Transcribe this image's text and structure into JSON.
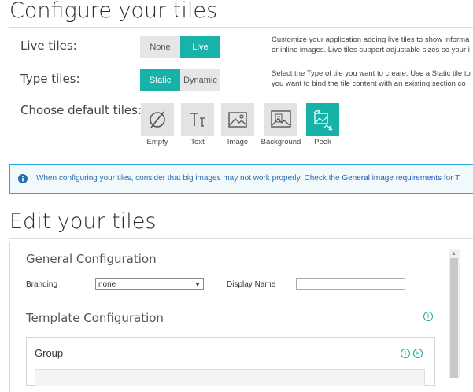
{
  "configure": {
    "title": "Configure your tiles",
    "live_tiles": {
      "label": "Live tiles:",
      "options": [
        "None",
        "Live"
      ],
      "selected": "Live",
      "description": [
        "Customize your application adding live tiles to show informa",
        "or inline images. Live tiles support adjustable sizes so your i"
      ]
    },
    "type_tiles": {
      "label": "Type tiles:",
      "options": [
        "Static",
        "Dynamic"
      ],
      "selected": "Static",
      "description": [
        "Select the Type of tile you want to create. Use a Static tile to",
        "you want to bind the tile content with an existing section co"
      ]
    },
    "default_tiles": {
      "label": "Choose default tiles:",
      "items": [
        {
          "label": "Empty",
          "icon": "empty-set-icon"
        },
        {
          "label": "Text",
          "icon": "text-icon"
        },
        {
          "label": "Image",
          "icon": "image-icon"
        },
        {
          "label": "Background",
          "icon": "background-icon"
        },
        {
          "label": "Peek",
          "icon": "peek-icon"
        }
      ],
      "selected": "Peek"
    }
  },
  "notice": {
    "text": "When configuring your tiles, consider that big images may not work properly. Check the ",
    "link": "General image requirements",
    "suffix": " for T"
  },
  "edit": {
    "title": "Edit your tiles",
    "general_title": "General Configuration",
    "branding_label": "Branding",
    "branding_value": "none",
    "display_name_label": "Display Name",
    "display_name_value": "",
    "template_title": "Template Configuration",
    "group_title": "Group"
  },
  "colors": {
    "accent": "#19b2a8",
    "notice_border": "#29a8e0"
  }
}
